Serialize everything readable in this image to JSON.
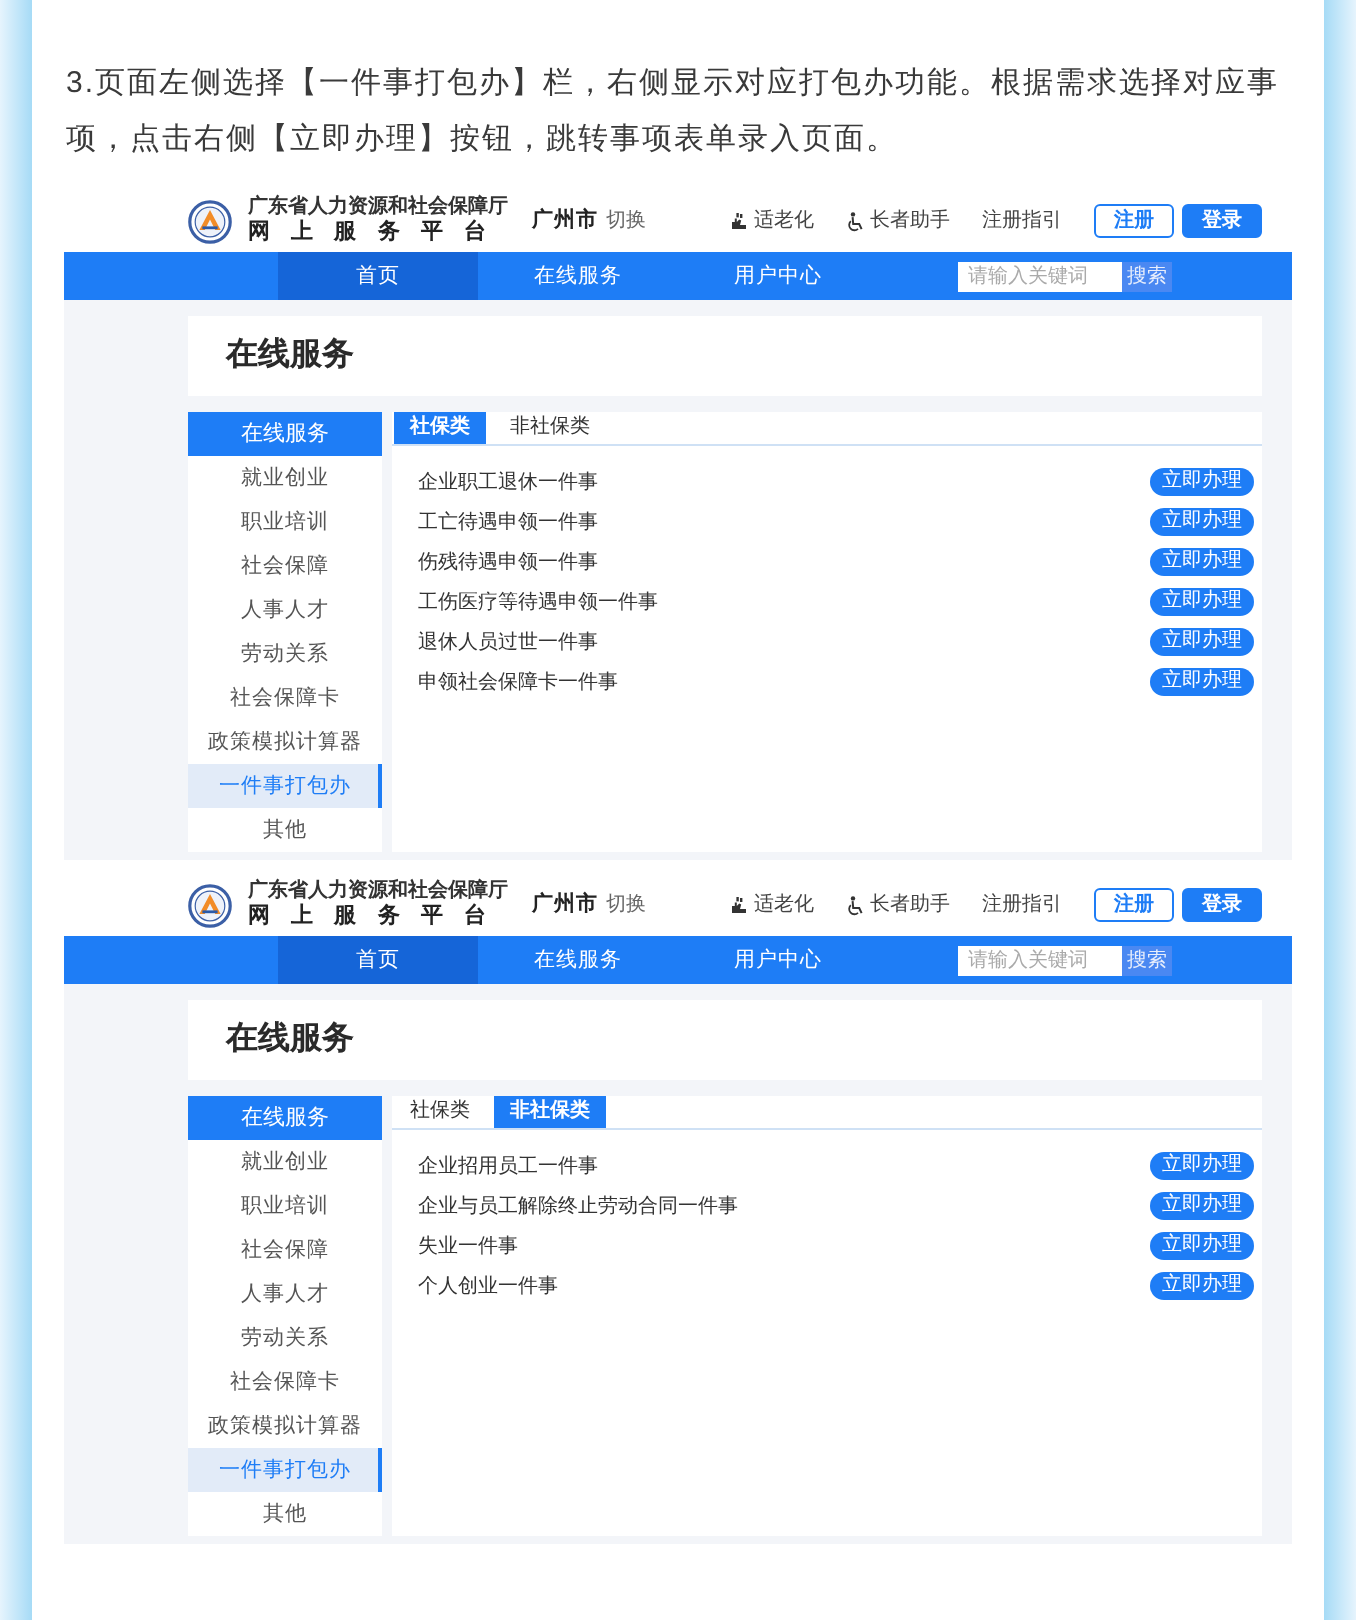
{
  "instruction": {
    "text": "3.页面左侧选择【一件事打包办】栏，右侧显示对应打包办功能。根据需求选择对应事项，点击右侧【立即办理】按钮，跳转事项表单录入页面。"
  },
  "screenshots": [
    {
      "header": {
        "org_name": "广东省人力资源和社会保障厅",
        "platform_name": "网上服务平台",
        "city": "广州市",
        "city_switch": "切换",
        "links": [
          {
            "kind": "elder",
            "label": "适老化"
          },
          {
            "kind": "helper",
            "label": "长者助手"
          },
          {
            "kind": "plain",
            "label": "注册指引"
          }
        ],
        "buttons": [
          {
            "kind": "outline",
            "label": "注册"
          },
          {
            "kind": "solid",
            "label": "登录"
          }
        ]
      },
      "nav": {
        "items": [
          {
            "label": "首页",
            "selected": true
          },
          {
            "label": "在线服务",
            "selected": false
          },
          {
            "label": "用户中心",
            "selected": false
          }
        ],
        "search": {
          "placeholder": "请输入关键词",
          "button": "搜索"
        }
      },
      "page_title": "在线服务",
      "sidebar": {
        "heading": "在线服务",
        "items": [
          {
            "label": "就业创业",
            "selected": false
          },
          {
            "label": "职业培训",
            "selected": false
          },
          {
            "label": "社会保障",
            "selected": false
          },
          {
            "label": "人事人才",
            "selected": false
          },
          {
            "label": "劳动关系",
            "selected": false
          },
          {
            "label": "社会保障卡",
            "selected": false
          },
          {
            "label": "政策模拟计算器",
            "selected": false
          },
          {
            "label": "一件事打包办",
            "selected": true
          },
          {
            "label": "其他",
            "selected": false
          }
        ]
      },
      "tabs": [
        {
          "label": "社保类",
          "selected": true
        },
        {
          "label": "非社保类",
          "selected": false
        }
      ],
      "services": [
        {
          "name": "企业职工退休一件事",
          "button": "立即办理"
        },
        {
          "name": "工亡待遇申领一件事",
          "button": "立即办理"
        },
        {
          "name": "伤残待遇申领一件事",
          "button": "立即办理"
        },
        {
          "name": "工伤医疗等待遇申领一件事",
          "button": "立即办理"
        },
        {
          "name": "退休人员过世一件事",
          "button": "立即办理"
        },
        {
          "name": "申领社会保障卡一件事",
          "button": "立即办理"
        }
      ]
    },
    {
      "header": {
        "org_name": "广东省人力资源和社会保障厅",
        "platform_name": "网上服务平台",
        "city": "广州市",
        "city_switch": "切换",
        "links": [
          {
            "kind": "elder",
            "label": "适老化"
          },
          {
            "kind": "helper",
            "label": "长者助手"
          },
          {
            "kind": "plain",
            "label": "注册指引"
          }
        ],
        "buttons": [
          {
            "kind": "outline",
            "label": "注册"
          },
          {
            "kind": "solid",
            "label": "登录"
          }
        ]
      },
      "nav": {
        "items": [
          {
            "label": "首页",
            "selected": true
          },
          {
            "label": "在线服务",
            "selected": false
          },
          {
            "label": "用户中心",
            "selected": false
          }
        ],
        "search": {
          "placeholder": "请输入关键词",
          "button": "搜索"
        }
      },
      "page_title": "在线服务",
      "sidebar": {
        "heading": "在线服务",
        "items": [
          {
            "label": "就业创业",
            "selected": false
          },
          {
            "label": "职业培训",
            "selected": false
          },
          {
            "label": "社会保障",
            "selected": false
          },
          {
            "label": "人事人才",
            "selected": false
          },
          {
            "label": "劳动关系",
            "selected": false
          },
          {
            "label": "社会保障卡",
            "selected": false
          },
          {
            "label": "政策模拟计算器",
            "selected": false
          },
          {
            "label": "一件事打包办",
            "selected": true
          },
          {
            "label": "其他",
            "selected": false
          }
        ]
      },
      "tabs": [
        {
          "label": "社保类",
          "selected": false
        },
        {
          "label": "非社保类",
          "selected": true
        }
      ],
      "services": [
        {
          "name": "企业招用员工一件事",
          "button": "立即办理"
        },
        {
          "name": "企业与员工解除终止劳动合同一件事",
          "button": "立即办理"
        },
        {
          "name": "失业一件事",
          "button": "立即办理"
        },
        {
          "name": "个人创业一件事",
          "button": "立即办理"
        }
      ]
    }
  ]
}
